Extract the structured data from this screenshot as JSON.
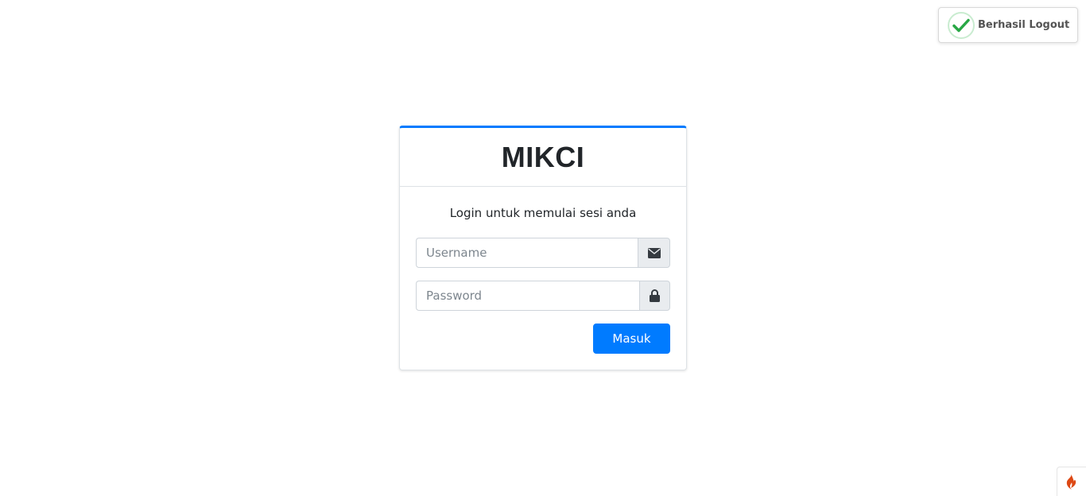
{
  "toast": {
    "message": "Berhasil Logout",
    "icon": "check-icon",
    "color": "#28a745"
  },
  "login": {
    "brand": "MIKCI",
    "message": "Login untuk memulai sesi anda",
    "username": {
      "value": "",
      "placeholder": "Username",
      "icon": "envelope-icon"
    },
    "password": {
      "value": "",
      "placeholder": "Password",
      "icon": "lock-icon"
    },
    "submit_label": "Masuk",
    "accent_color": "#007bff"
  },
  "debug_toolbar": {
    "icon": "codeigniter-flame-icon",
    "color": "#dd4814"
  }
}
